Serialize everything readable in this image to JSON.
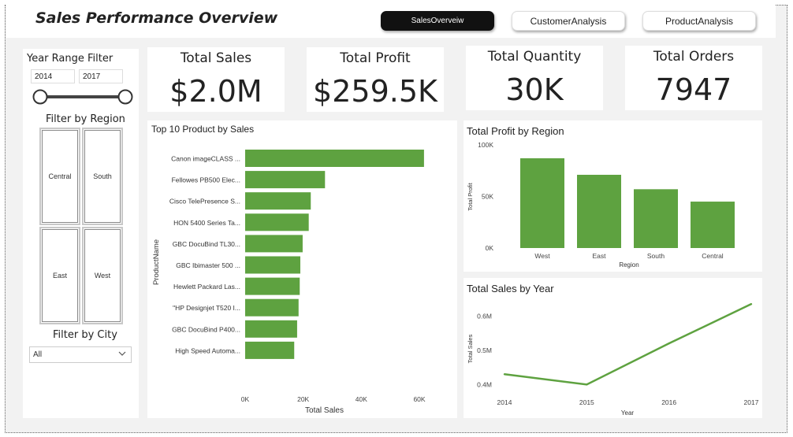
{
  "header": {
    "title": "Sales Performance Overview",
    "nav": [
      {
        "label": "SalesOverveiw",
        "active": true
      },
      {
        "label": "CustomerAnalysis",
        "active": false
      },
      {
        "label": "ProductAnalysis",
        "active": false
      }
    ]
  },
  "filters": {
    "year_range_title": "Year Range Filter",
    "year_start": "2014",
    "year_end": "2017",
    "region_title": "Filter by Region",
    "regions": [
      "Central",
      "South",
      "East",
      "West"
    ],
    "city_title": "Filter by City",
    "city_value": "All"
  },
  "kpis": [
    {
      "label": "Total Sales",
      "value": "$2.0M"
    },
    {
      "label": "Total Profit",
      "value": "$259.5K"
    },
    {
      "label": "Total Quantity",
      "value": "30K"
    },
    {
      "label": "Total Orders",
      "value": "7947"
    }
  ],
  "colors": {
    "bar": "#5ea240",
    "text": "#222222"
  },
  "chart_data": [
    {
      "type": "bar",
      "orientation": "horizontal",
      "title": "Top 10 Product by Sales",
      "xlabel": "Total Sales",
      "ylabel": "ProductName",
      "categories": [
        "Canon imageCLASS ...",
        "Fellowes PB500 Elec...",
        "Cisco TelePresence S...",
        "HON 5400 Series Ta...",
        "GBC DocuBind TL30...",
        "GBC Ibimaster 500 ...",
        "Hewlett Packard Las...",
        "\"HP Designjet T520 I...",
        "GBC DocuBind P400...",
        "High Speed Automa..."
      ],
      "values": [
        61600,
        27500,
        22600,
        21900,
        19800,
        19000,
        18800,
        18400,
        17900,
        16900
      ],
      "xlim": [
        0,
        60000
      ],
      "xticks": [
        0,
        20000,
        40000,
        60000
      ],
      "xtick_labels": [
        "0K",
        "20K",
        "40K",
        "60K"
      ],
      "grid": false
    },
    {
      "type": "bar",
      "title": "Total Profit by Region",
      "xlabel": "Region",
      "ylabel": "Total Profit",
      "categories": [
        "West",
        "East",
        "South",
        "Central"
      ],
      "values": [
        87000,
        71000,
        57000,
        45000
      ],
      "ylim": [
        0,
        100000
      ],
      "yticks": [
        0,
        50000,
        100000
      ],
      "ytick_labels": [
        "0K",
        "50K",
        "100K"
      ],
      "grid": false
    },
    {
      "type": "line",
      "title": "Total Sales by Year",
      "xlabel": "Year",
      "ylabel": "Total Sales",
      "x": [
        "2014",
        "2015",
        "2016",
        "2017"
      ],
      "values": [
        0.43,
        0.4,
        0.52,
        0.635
      ],
      "value_unit": "M",
      "ylim": [
        0.38,
        0.64
      ],
      "yticks": [
        0.4,
        0.5,
        0.6
      ],
      "ytick_labels": [
        "0.4M",
        "0.5M",
        "0.6M"
      ],
      "grid": false
    }
  ]
}
